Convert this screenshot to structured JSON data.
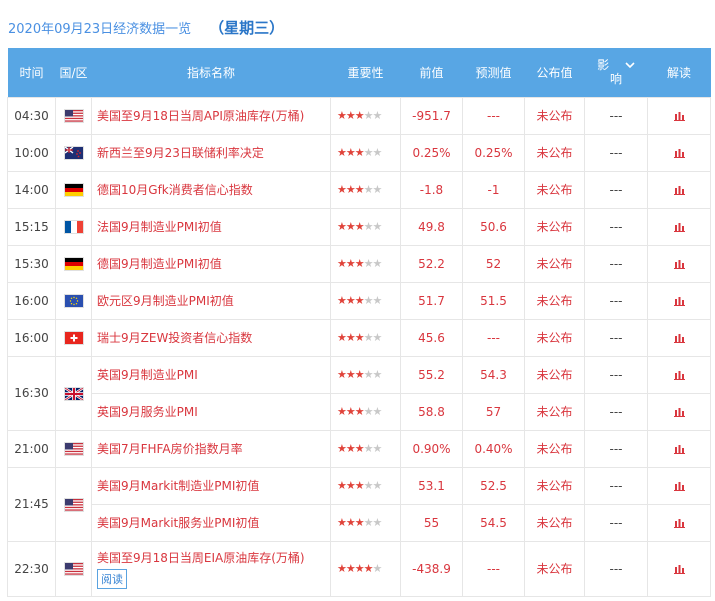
{
  "page": {
    "date_label": "2020年09月23日经济数据一览",
    "weekday_label": "（星期三）"
  },
  "table": {
    "headers": {
      "time": "时间",
      "country": "国/区",
      "indicator": "指标名称",
      "importance": "重要性",
      "previous": "前值",
      "forecast": "预测值",
      "actual": "公布值",
      "influence_top": "影",
      "influence_bottom": "响",
      "interpret": "解读"
    },
    "rows": [
      {
        "time": "04:30",
        "flag": "us-flag-icon",
        "name": "美国至9月18日当周API原油库存(万桶)",
        "stars": 3,
        "prev": "-951.7",
        "fore": "---",
        "actual": "未公布",
        "influence": "---"
      },
      {
        "time": "10:00",
        "flag": "nz-flag-icon",
        "name": "新西兰至9月23日联储利率决定",
        "stars": 3,
        "prev": "0.25%",
        "fore": "0.25%",
        "actual": "未公布",
        "influence": "---"
      },
      {
        "time": "14:00",
        "flag": "de-flag-icon",
        "name": "德国10月Gfk消费者信心指数",
        "stars": 3,
        "prev": "-1.8",
        "fore": "-1",
        "actual": "未公布",
        "influence": "---"
      },
      {
        "time": "15:15",
        "flag": "fr-flag-icon",
        "name": "法国9月制造业PMI初值",
        "stars": 3,
        "prev": "49.8",
        "fore": "50.6",
        "actual": "未公布",
        "influence": "---"
      },
      {
        "time": "15:30",
        "flag": "de-flag-icon",
        "name": "德国9月制造业PMI初值",
        "stars": 3,
        "prev": "52.2",
        "fore": "52",
        "actual": "未公布",
        "influence": "---"
      },
      {
        "time": "16:00",
        "flag": "eu-flag-icon",
        "name": "欧元区9月制造业PMI初值",
        "stars": 3,
        "prev": "51.7",
        "fore": "51.5",
        "actual": "未公布",
        "influence": "---"
      },
      {
        "time": "16:00",
        "flag": "ch-flag-icon",
        "name": "瑞士9月ZEW投资者信心指数",
        "stars": 3,
        "prev": "45.6",
        "fore": "---",
        "actual": "未公布",
        "influence": "---"
      },
      {
        "time": "16:30",
        "flag": "gb-flag-icon",
        "name": "英国9月制造业PMI",
        "stars": 3,
        "prev": "55.2",
        "fore": "54.3",
        "actual": "未公布",
        "influence": "---"
      },
      {
        "name": "英国9月服务业PMI",
        "stars": 3,
        "prev": "58.8",
        "fore": "57",
        "actual": "未公布",
        "influence": "---"
      },
      {
        "time": "21:00",
        "flag": "us-flag-icon",
        "name": "美国7月FHFA房价指数月率",
        "stars": 3,
        "prev": "0.90%",
        "fore": "0.40%",
        "actual": "未公布",
        "influence": "---"
      },
      {
        "time": "21:45",
        "flag": "us-flag-icon",
        "name": "美国9月Markit制造业PMI初值",
        "stars": 3,
        "prev": "53.1",
        "fore": "52.5",
        "actual": "未公布",
        "influence": "---"
      },
      {
        "name": "美国9月Markit服务业PMI初值",
        "stars": 3,
        "prev": "55",
        "fore": "54.5",
        "actual": "未公布",
        "influence": "---"
      },
      {
        "time": "22:30",
        "flag": "us-flag-icon",
        "name": "美国至9月18日当周EIA原油库存(万桶)",
        "read_label": "阅读",
        "stars": 4,
        "prev": "-438.9",
        "fore": "---",
        "actual": "未公布",
        "influence": "---"
      }
    ]
  },
  "colors": {
    "header_bg": "#58a6e4",
    "accent_red": "#d9363e",
    "link_blue": "#4a90e2"
  }
}
